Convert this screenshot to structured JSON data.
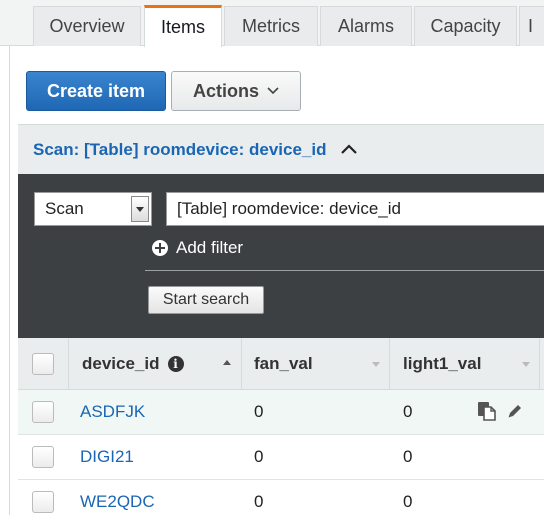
{
  "tabs": [
    {
      "label": "Overview"
    },
    {
      "label": "Items"
    },
    {
      "label": "Metrics"
    },
    {
      "label": "Alarms"
    },
    {
      "label": "Capacity"
    },
    {
      "label": "I"
    }
  ],
  "toolbar": {
    "create_label": "Create item",
    "actions_label": "Actions"
  },
  "scan_panel": {
    "header": "Scan: [Table] roomdevice: device_id",
    "mode_value": "Scan",
    "table_value": "[Table] roomdevice: device_id",
    "add_filter_label": "Add filter",
    "start_label": "Start search"
  },
  "table": {
    "columns": [
      "device_id",
      "fan_val",
      "light1_val"
    ],
    "rows": [
      {
        "device_id": "ASDFJK",
        "fan_val": "0",
        "light1_val": "0"
      },
      {
        "device_id": "DIGI21",
        "fan_val": "0",
        "light1_val": "0"
      },
      {
        "device_id": "WE2QDC",
        "fan_val": "0",
        "light1_val": "0"
      }
    ]
  },
  "colors": {
    "accent": "#ec7211",
    "primary": "#1f67b4",
    "link": "#1a66b5",
    "panel_dark": "#3d4043"
  }
}
